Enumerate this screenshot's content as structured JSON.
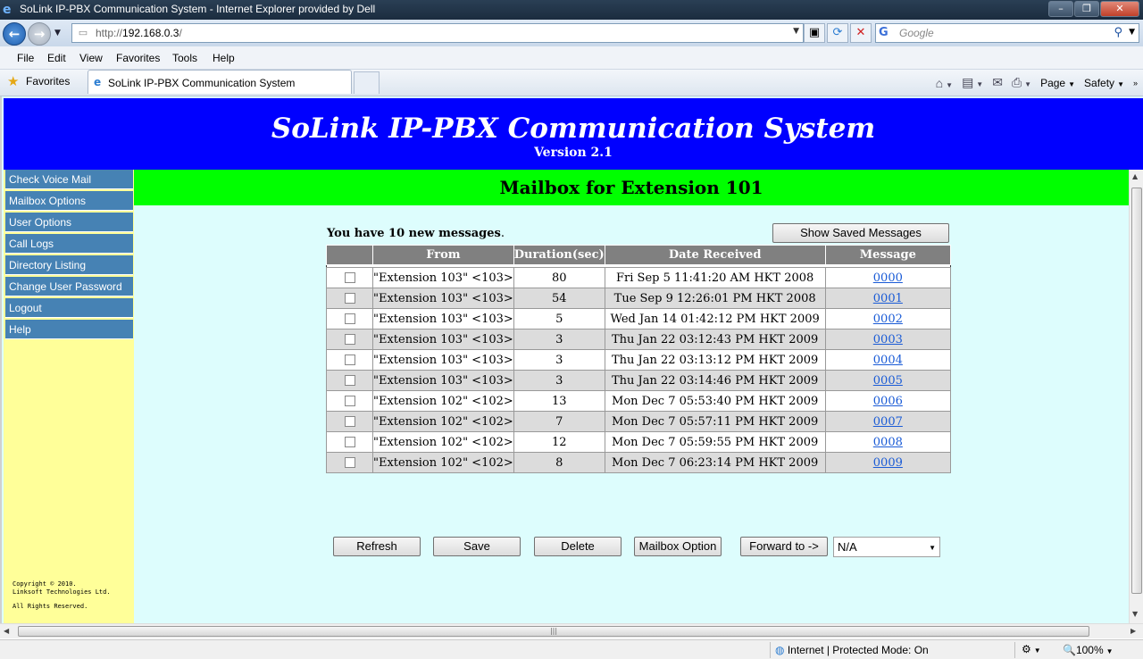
{
  "window": {
    "title": "SoLink IP-PBX Communication System - Internet Explorer provided by Dell"
  },
  "address_bar": {
    "url_prefix": "http://",
    "url_host": "192.168.0.3",
    "url_suffix": "/",
    "search_placeholder": "Google"
  },
  "menu": [
    "File",
    "Edit",
    "View",
    "Favorites",
    "Tools",
    "Help"
  ],
  "favorites": {
    "label": "Favorites",
    "tab_title": "SoLink IP-PBX Communication System",
    "commands": {
      "page": "Page",
      "safety": "Safety"
    }
  },
  "header": {
    "title": "SoLink IP-PBX Communication System",
    "version": "Version 2.1"
  },
  "sidebar": {
    "items": [
      "Check Voice Mail",
      "Mailbox Options",
      "User Options",
      "Call Logs",
      "Directory Listing",
      "Change User Password",
      "Logout",
      "Help"
    ],
    "copyright": [
      "Copyright © 2010.",
      "Linksoft Technologies Ltd.",
      "",
      "All Rights Reserved."
    ]
  },
  "mailbox": {
    "title": "Mailbox for Extension 101",
    "count_prefix": "You have ",
    "count_value": "10 new messages",
    "count_suffix": ".",
    "show_saved_label": "Show Saved Messages",
    "columns": [
      "",
      "From",
      "Duration(sec)",
      "Date Received",
      "Message"
    ],
    "rows": [
      {
        "from": "\"Extension 103\" <103>",
        "duration": "80",
        "date": "Fri Sep 5 11:41:20 AM HKT 2008",
        "message": "0000"
      },
      {
        "from": "\"Extension 103\" <103>",
        "duration": "54",
        "date": "Tue Sep 9 12:26:01 PM HKT 2008",
        "message": "0001"
      },
      {
        "from": "\"Extension 103\" <103>",
        "duration": "5",
        "date": "Wed Jan 14 01:42:12 PM HKT 2009",
        "message": "0002"
      },
      {
        "from": "\"Extension 103\" <103>",
        "duration": "3",
        "date": "Thu Jan 22 03:12:43 PM HKT 2009",
        "message": "0003"
      },
      {
        "from": "\"Extension 103\" <103>",
        "duration": "3",
        "date": "Thu Jan 22 03:13:12 PM HKT 2009",
        "message": "0004"
      },
      {
        "from": "\"Extension 103\" <103>",
        "duration": "3",
        "date": "Thu Jan 22 03:14:46 PM HKT 2009",
        "message": "0005"
      },
      {
        "from": "\"Extension 102\" <102>",
        "duration": "13",
        "date": "Mon Dec 7 05:53:40 PM HKT 2009",
        "message": "0006"
      },
      {
        "from": "\"Extension 102\" <102>",
        "duration": "7",
        "date": "Mon Dec 7 05:57:11 PM HKT 2009",
        "message": "0007"
      },
      {
        "from": "\"Extension 102\" <102>",
        "duration": "12",
        "date": "Mon Dec 7 05:59:55 PM HKT 2009",
        "message": "0008"
      },
      {
        "from": "\"Extension 102\" <102>",
        "duration": "8",
        "date": "Mon Dec 7 06:23:14 PM HKT 2009",
        "message": "0009"
      }
    ],
    "buttons": {
      "refresh": "Refresh",
      "save": "Save",
      "delete": "Delete",
      "mailbox_option": "Mailbox Option",
      "forward": "Forward to ->"
    },
    "forward_selected": "N/A"
  },
  "status": {
    "zone": "Internet | Protected Mode: On",
    "zoom": "100%"
  },
  "colors": {
    "header_bg": "#0000ff",
    "mailbox_band": "#00ff00",
    "sidebar_bg": "#ffff99",
    "sidebar_item": "#4682b4",
    "content_bg": "#ddfdfd",
    "table_header": "#808080",
    "link": "#1a5bd6"
  }
}
